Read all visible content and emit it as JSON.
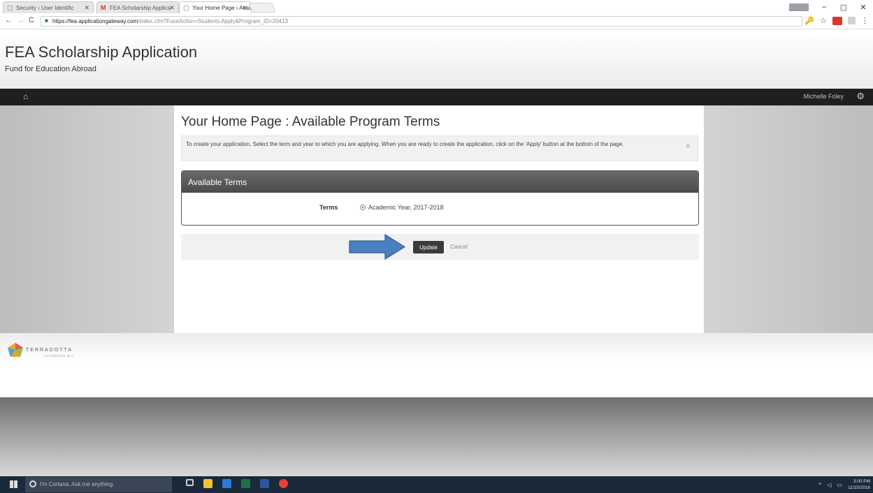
{
  "browser": {
    "tabs": [
      {
        "label": "Security › User Identific",
        "active": false
      },
      {
        "label": "FEA Scholarship Applica",
        "active": false
      },
      {
        "label": "Your Home Page › Avail",
        "active": true
      }
    ],
    "url_host": "https://fea.applicationgateway.com",
    "url_rest": "/index.cfm?FuseAction=Students.Apply&Program_ID=20413"
  },
  "site": {
    "title": "FEA Scholarship Application",
    "subtitle": "Fund for Education Abroad"
  },
  "navbar": {
    "user_name": "Michelle Foley"
  },
  "main": {
    "page_title": "Your Home Page : Available Program Terms",
    "alert_text": "To create your application, Select the term and year to which you are applying. When you are ready to create the application, click on the 'Apply' button at the bottom of the page.",
    "panel_heading": "Available Terms",
    "terms_label": "Terms",
    "term_value": "Academic Year, 2017-2018",
    "update_label": "Update",
    "cancel_label": "Cancel"
  },
  "footer": {
    "logo_text": "TERRADOTTA",
    "logo_sub": "(POWERED BY)"
  },
  "taskbar": {
    "cortana_placeholder": "I'm Cortana. Ask me anything.",
    "time": "3:00 PM",
    "date": "11/15/2016"
  },
  "colors": {
    "navbar": "#1f1f1f",
    "panel_heading": "#555555",
    "update_button": "#3b3b3b",
    "annotation_arrow": "#4a7fc0",
    "taskbar": "#1b2a3a"
  }
}
